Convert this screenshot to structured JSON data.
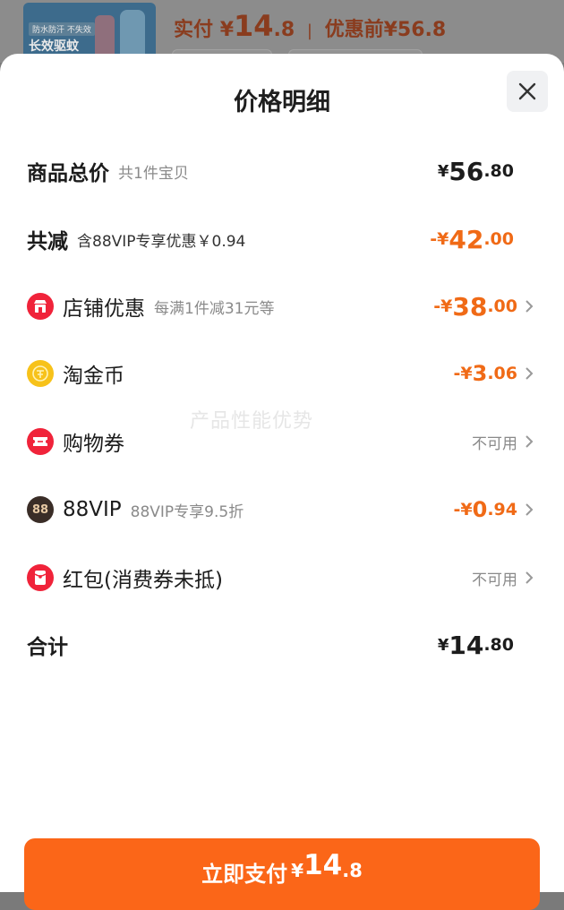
{
  "background": {
    "product_tag": "防水防汗 不失效",
    "product_title": "长效驱蚊",
    "paid_prefix": "实付",
    "paid_currency": "¥",
    "paid_int": "14",
    "paid_dec": ".8",
    "separator": "|",
    "before_discount": "优惠前¥56.8"
  },
  "sheet": {
    "title": "价格明细",
    "watermark": "产品性能优势"
  },
  "rows": {
    "total": {
      "label": "商品总价",
      "sub": "共1件宝贝",
      "cur": "¥",
      "int": "56",
      "dec": ".80"
    },
    "reduce": {
      "label": "共减",
      "sub": "含88VIP专享优惠￥0.94",
      "cur": "-¥",
      "int": "42",
      "dec": ".00"
    },
    "shop": {
      "label": "店铺优惠",
      "sub": "每满1件减31元等",
      "cur": "-¥",
      "int": "38",
      "dec": ".00"
    },
    "coin": {
      "label": "淘金币",
      "cur": "-¥",
      "int": "3",
      "dec": ".06"
    },
    "coupon": {
      "label": "购物券",
      "value": "不可用"
    },
    "vip": {
      "label": "88VIP",
      "sub": "88VIP专享9.5折",
      "cur": "-¥",
      "int": "0",
      "dec": ".94",
      "icon_text": "88"
    },
    "redpacket": {
      "label": "红包(消费券未抵)",
      "value": "不可用"
    },
    "sum": {
      "label": "合计",
      "cur": "¥",
      "int": "14",
      "dec": ".80"
    }
  },
  "pay_button": {
    "label": "立即支付",
    "cur": "¥",
    "int": "14",
    "dec": ".8"
  },
  "colors": {
    "accent": "#fb6618",
    "discount": "#f06a16",
    "red_icon": "#f0233a",
    "gold_icon": "#f7c21a",
    "vip_icon": "#3a2d27"
  }
}
